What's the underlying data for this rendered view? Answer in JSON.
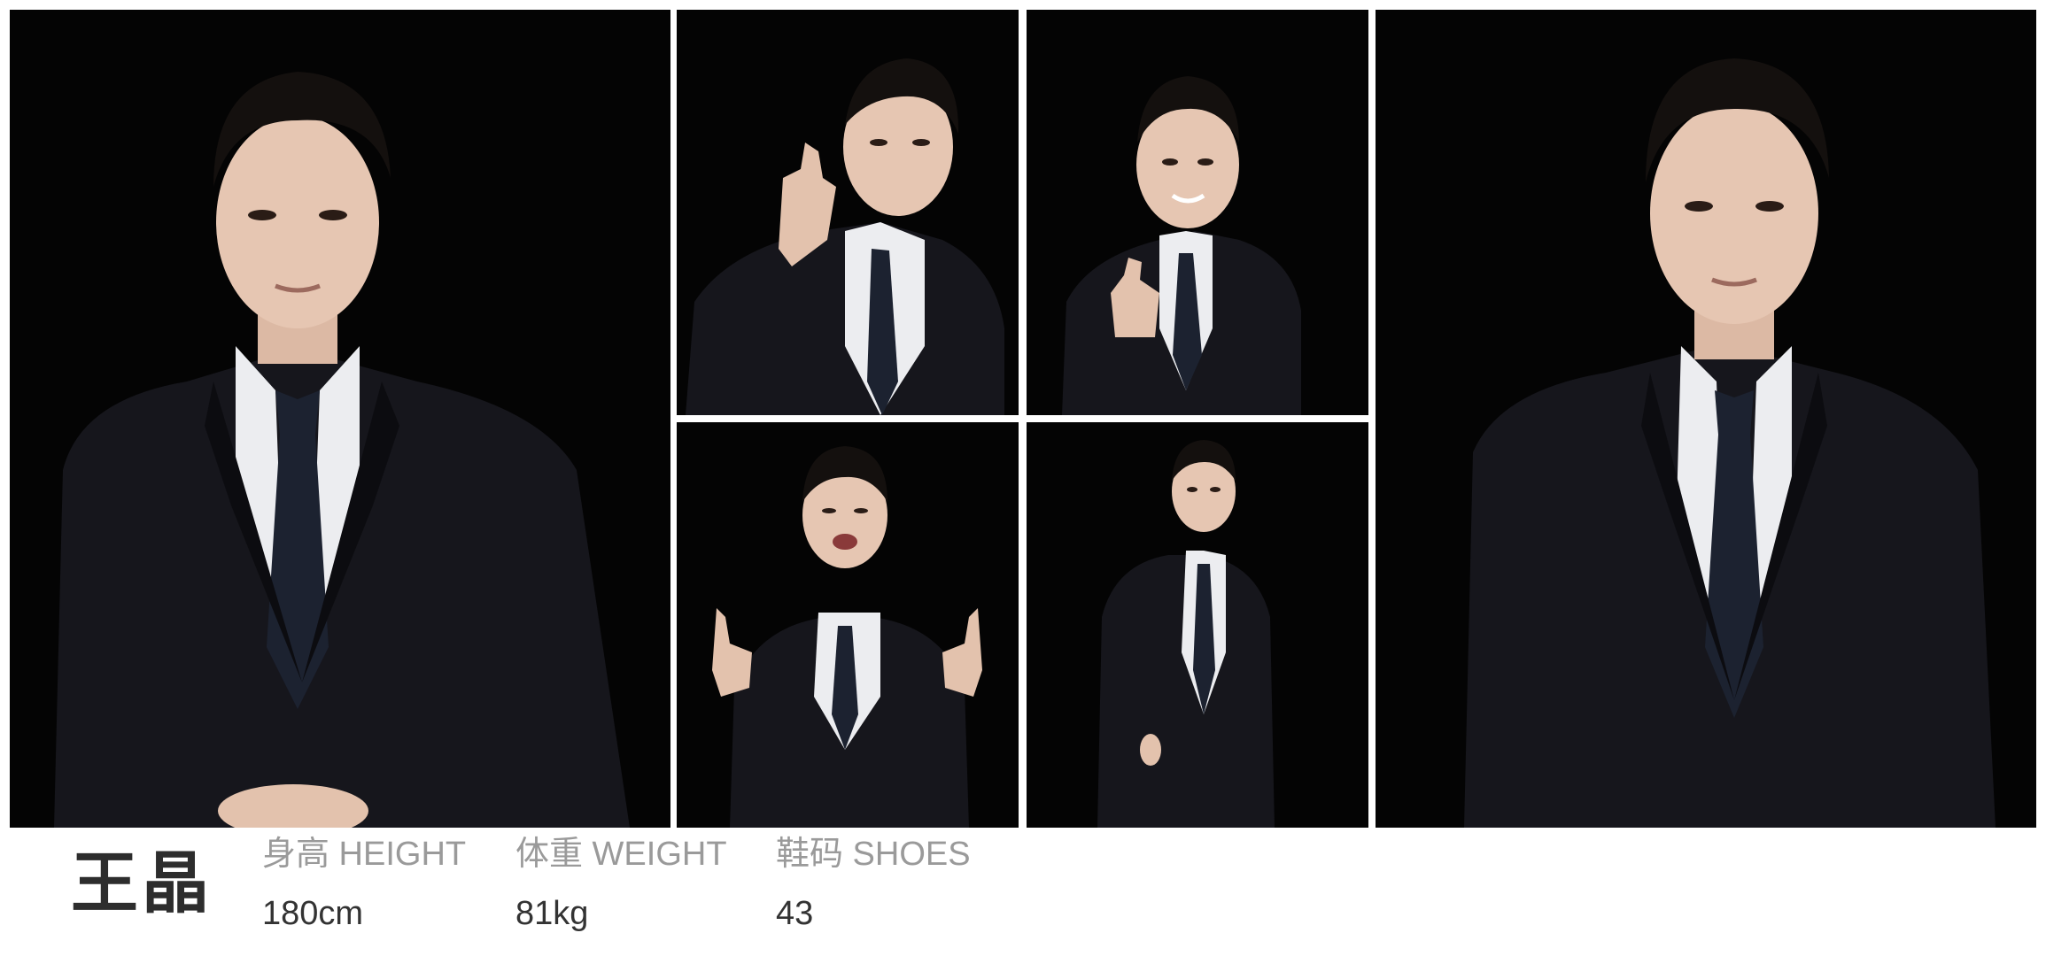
{
  "profile": {
    "name": "王晶",
    "stats": [
      {
        "label": "身高 HEIGHT",
        "value": "180cm"
      },
      {
        "label": "体重 WEIGHT",
        "value": "81kg"
      },
      {
        "label": "鞋码 SHOES",
        "value": "43"
      }
    ]
  },
  "photos": [
    {
      "pose": "portrait-front"
    },
    {
      "pose": "hand-wave-tilt"
    },
    {
      "pose": "pointing"
    },
    {
      "pose": "double-thumbs"
    },
    {
      "pose": "full-body-standing"
    },
    {
      "pose": "portrait-front-close"
    }
  ],
  "colors": {
    "background": "#ffffff",
    "photo_backdrop": "#040404",
    "suit": "#16161c",
    "shirt": "#ecedf0",
    "tie": "#1c2230",
    "skin": "#e6c6b2",
    "hair": "#14100e",
    "label_text": "#9a9a9a",
    "value_text": "#333333",
    "name_text": "#2d2d2d"
  }
}
